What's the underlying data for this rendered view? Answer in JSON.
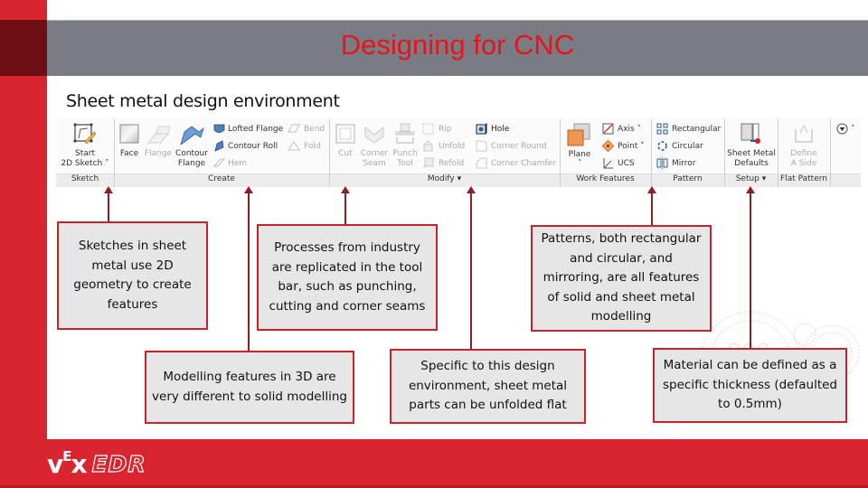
{
  "slide": {
    "title": "Designing for CNC",
    "subtitle": "Sheet metal design environment",
    "colors": {
      "brand_red": "#d9252f",
      "dark_red": "#6e0f14",
      "title_bar": "#797c83",
      "title_text": "#e8131c",
      "callout_border": "#c8232b",
      "callout_fill": "#e6e6e6"
    }
  },
  "ribbon": {
    "groups": {
      "sketch": "Sketch",
      "create": "Create",
      "modify": "Modify ▾",
      "work_features": "Work Features",
      "pattern": "Pattern",
      "setup": "Setup ▾",
      "flat_pattern": "Flat Pattern"
    },
    "sketch": {
      "start_line1": "Start",
      "start_line2": "2D Sketch ˅"
    },
    "create": {
      "face": "Face",
      "flange": "Flange",
      "contour_flange_1": "Contour",
      "contour_flange_2": "Flange",
      "lofted_flange": "Lofted Flange",
      "contour_roll": "Contour Roll",
      "hem": "Hem",
      "bend": "Bend",
      "fold": "Fold"
    },
    "modify": {
      "cut": "Cut",
      "corner_seam_1": "Corner",
      "corner_seam_2": "Seam",
      "punch_tool_1": "Punch",
      "punch_tool_2": "Tool",
      "rip": "Rip",
      "unfold": "Unfold",
      "refold": "Refold",
      "hole": "Hole",
      "corner_round": "Corner Round",
      "corner_chamfer": "Corner Chamfer"
    },
    "work_features": {
      "plane": "Plane",
      "plane_arrow": "˅",
      "axis": "Axis ˅",
      "point": "Point ˅",
      "ucs": "UCS"
    },
    "pattern": {
      "rectangular": "Rectangular",
      "circular": "Circular",
      "mirror": "Mirror"
    },
    "setup": {
      "defaults_1": "Sheet Metal",
      "defaults_2": "Defaults"
    },
    "flat_pattern": {
      "define_1": "Define",
      "define_2": "A Side"
    },
    "overflow": "˅"
  },
  "callouts": [
    {
      "id": "sketches",
      "text": "Sketches in sheet metal use 2D geometry to create features"
    },
    {
      "id": "processes",
      "text": "Processes from industry are replicated in the tool bar, such as punching, cutting and corner seams"
    },
    {
      "id": "modelling",
      "text": "Modelling features in 3D are very different to solid modelling"
    },
    {
      "id": "patterns",
      "text": "Patterns, both rectangular and circular, and mirroring, are all features of solid and sheet metal modelling"
    },
    {
      "id": "unfold",
      "text": "Specific to this design environment, sheet metal parts can be unfolded flat"
    },
    {
      "id": "material",
      "text": "Material can be defined as a specific thickness (defaulted to 0.5mm)"
    }
  ],
  "footer": {
    "logo_v": "v",
    "logo_e": "E",
    "logo_x": "x",
    "logo_edr": "EDR"
  }
}
